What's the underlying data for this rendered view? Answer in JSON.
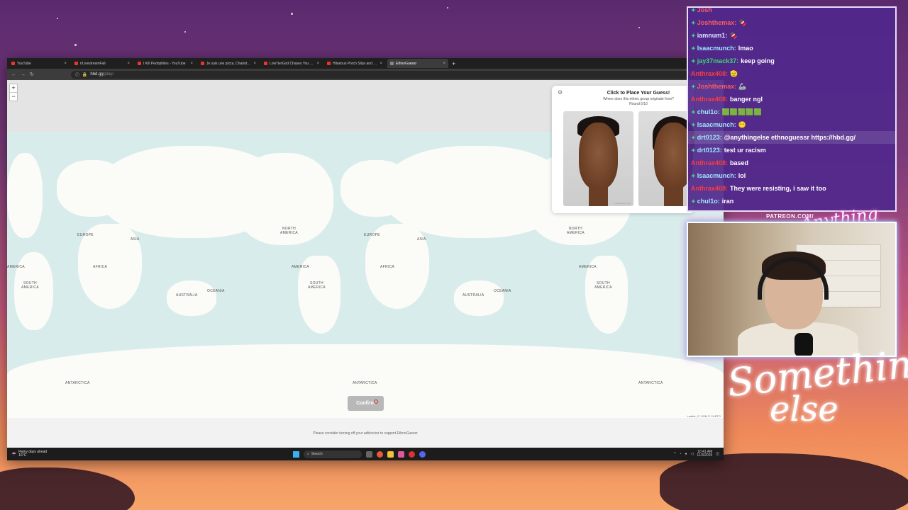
{
  "browser": {
    "tabs": [
      {
        "label": "YouTube",
        "active": false,
        "favicon": "youtube-icon"
      },
      {
        "label": "r/LivestreamFail",
        "active": false,
        "favicon": "reddit-icon"
      },
      {
        "label": "I Kill Pedophiles - YouTube",
        "active": false,
        "favicon": "youtube-icon"
      },
      {
        "label": "Je suis une pizza, Charlotte Dix",
        "active": false,
        "favicon": "youtube-icon"
      },
      {
        "label": "LowTierGod Chases You Down",
        "active": false,
        "favicon": "youtube-icon"
      },
      {
        "label": "Hilarious Porch Slips and CCTV",
        "active": false,
        "favicon": "youtube-icon"
      },
      {
        "label": "EthnoGuessr",
        "active": true,
        "favicon": "site-icon"
      }
    ],
    "new_tab": "+",
    "url_host": "hbd.gg",
    "url_path": "/play/"
  },
  "game": {
    "zoom_in": "+",
    "zoom_out": "−",
    "panel_title": "Click to Place Your Guess!",
    "panel_subtitle": "Where does this ethnic group originate from?",
    "round": "Round 5/10",
    "image_watermark": "ethnoguessr.com",
    "confirm_label": "Confirm",
    "adblock_notice": "Please consider turning off your adblocker to support EthnoGuessr",
    "attribution": "Leaflet | © OSM © CARTO",
    "map_labels": {
      "europe": "EUROPE",
      "asia": "ASIA",
      "africa": "AFRICA",
      "australia": "AUSTRALIA",
      "oceania": "OCEANIA",
      "north_america": "NORTH\nAMERICA",
      "south_america": "SOUTH\nAMERICA",
      "america": "AMERICA",
      "antarctica": "ANTARCTICA"
    }
  },
  "taskbar": {
    "weather_line1": "Rainy days ahead",
    "weather_line2": "16°C",
    "search_placeholder": "Search",
    "time": "10:41 AM",
    "date": "11/3/2025"
  },
  "chat": {
    "messages": [
      {
        "user": "Josh",
        "user_color": "#ff5c5c",
        "msg": "",
        "badge": true
      },
      {
        "user": "Joshthemax:",
        "user_color": "#ff5c5c",
        "msg": "🍫",
        "badge": true
      },
      {
        "user": "iamnum1:",
        "user_color": "#e0e0ff",
        "msg": "🍫",
        "badge": true
      },
      {
        "user": "Isaacmunch:",
        "user_color": "#9fe6ff",
        "msg": "lmao",
        "badge": true
      },
      {
        "user": "jay37mack37:",
        "user_color": "#3fd47a",
        "msg": "keep going",
        "badge": true
      },
      {
        "user": "Anthrax408:",
        "user_color": "#ff3b3b",
        "msg": "🫡",
        "badge": false
      },
      {
        "user": "Joshthemax:",
        "user_color": "#ff5c5c",
        "msg": "🦾",
        "badge": true
      },
      {
        "user": "Anthrax408:",
        "user_color": "#ff3b3b",
        "msg": "banger ngl",
        "badge": false
      },
      {
        "user": "chul1o:",
        "user_color": "#9fe6ff",
        "msg": "🟩🟩🟩🟩🟩",
        "badge": true
      },
      {
        "user": "Isaacmunch:",
        "user_color": "#9fe6ff",
        "msg": "😶",
        "badge": true
      },
      {
        "user": "drt0123:",
        "user_color": "#9fe6ff",
        "msg": "@anythingelse ethnoguessr https://hbd.gg/",
        "badge": true,
        "highlight": true
      },
      {
        "user": "drt0123:",
        "user_color": "#9fe6ff",
        "msg": "test ur racism",
        "badge": true
      },
      {
        "user": "Anthrax408:",
        "user_color": "#ff3b3b",
        "msg": "based",
        "badge": false
      },
      {
        "user": "Isaacmunch:",
        "user_color": "#9fe6ff",
        "msg": "lol",
        "badge": true
      },
      {
        "user": "Anthrax408:",
        "user_color": "#ff3b3b",
        "msg": "They were resisting, i saw it too",
        "badge": false
      },
      {
        "user": "chul1o:",
        "user_color": "#9fe6ff",
        "msg": "iran",
        "badge": true
      }
    ]
  },
  "overlay": {
    "patreon": "PATREON.COM/",
    "signature_small": "Anything else",
    "signature_big_1": "Something",
    "signature_big_2": "else"
  },
  "colors": {
    "accent_purple": "#6a3aa8",
    "badge_green": "#3fd47a",
    "map_water": "#d9ecec",
    "map_land": "#fbfbf8"
  }
}
